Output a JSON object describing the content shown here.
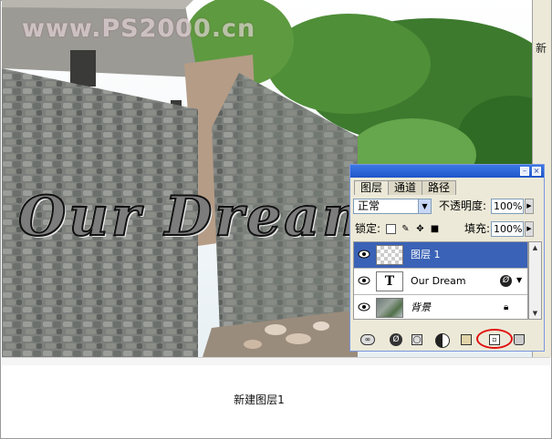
{
  "watermark": "www.PS2000.cn",
  "artwork_text": "Our Dream",
  "side_panel_char": "新",
  "caption": "新建图层1",
  "layers_palette": {
    "titlebar_buttons": [
      "–",
      "×"
    ],
    "tabs": [
      {
        "label": "图层",
        "active": true
      },
      {
        "label": "通道",
        "active": false
      },
      {
        "label": "路径",
        "active": false
      }
    ],
    "blend_mode": "正常",
    "opacity_label": "不透明度:",
    "opacity_value": "100%",
    "lock_label": "锁定:",
    "fill_label": "填充:",
    "fill_value": "100%",
    "layers": [
      {
        "name": "图层 1",
        "selected": true,
        "thumb": "transparent-checker"
      },
      {
        "name": "Our Dream",
        "selected": false,
        "thumb": "text-T",
        "thumb_label": "T",
        "fx": "Ø"
      },
      {
        "name": "背景",
        "selected": false,
        "thumb": "image",
        "locked": true
      }
    ],
    "bottom_tools": [
      "link-icon",
      "layer-style-icon",
      "mask-icon",
      "adjustment-layer-icon",
      "folder-icon",
      "new-layer-icon",
      "trash-icon"
    ]
  },
  "colors": {
    "selected_layer": "#3a62b6",
    "titlebar": "#2a63d8",
    "highlight_circle": "#e01010"
  }
}
